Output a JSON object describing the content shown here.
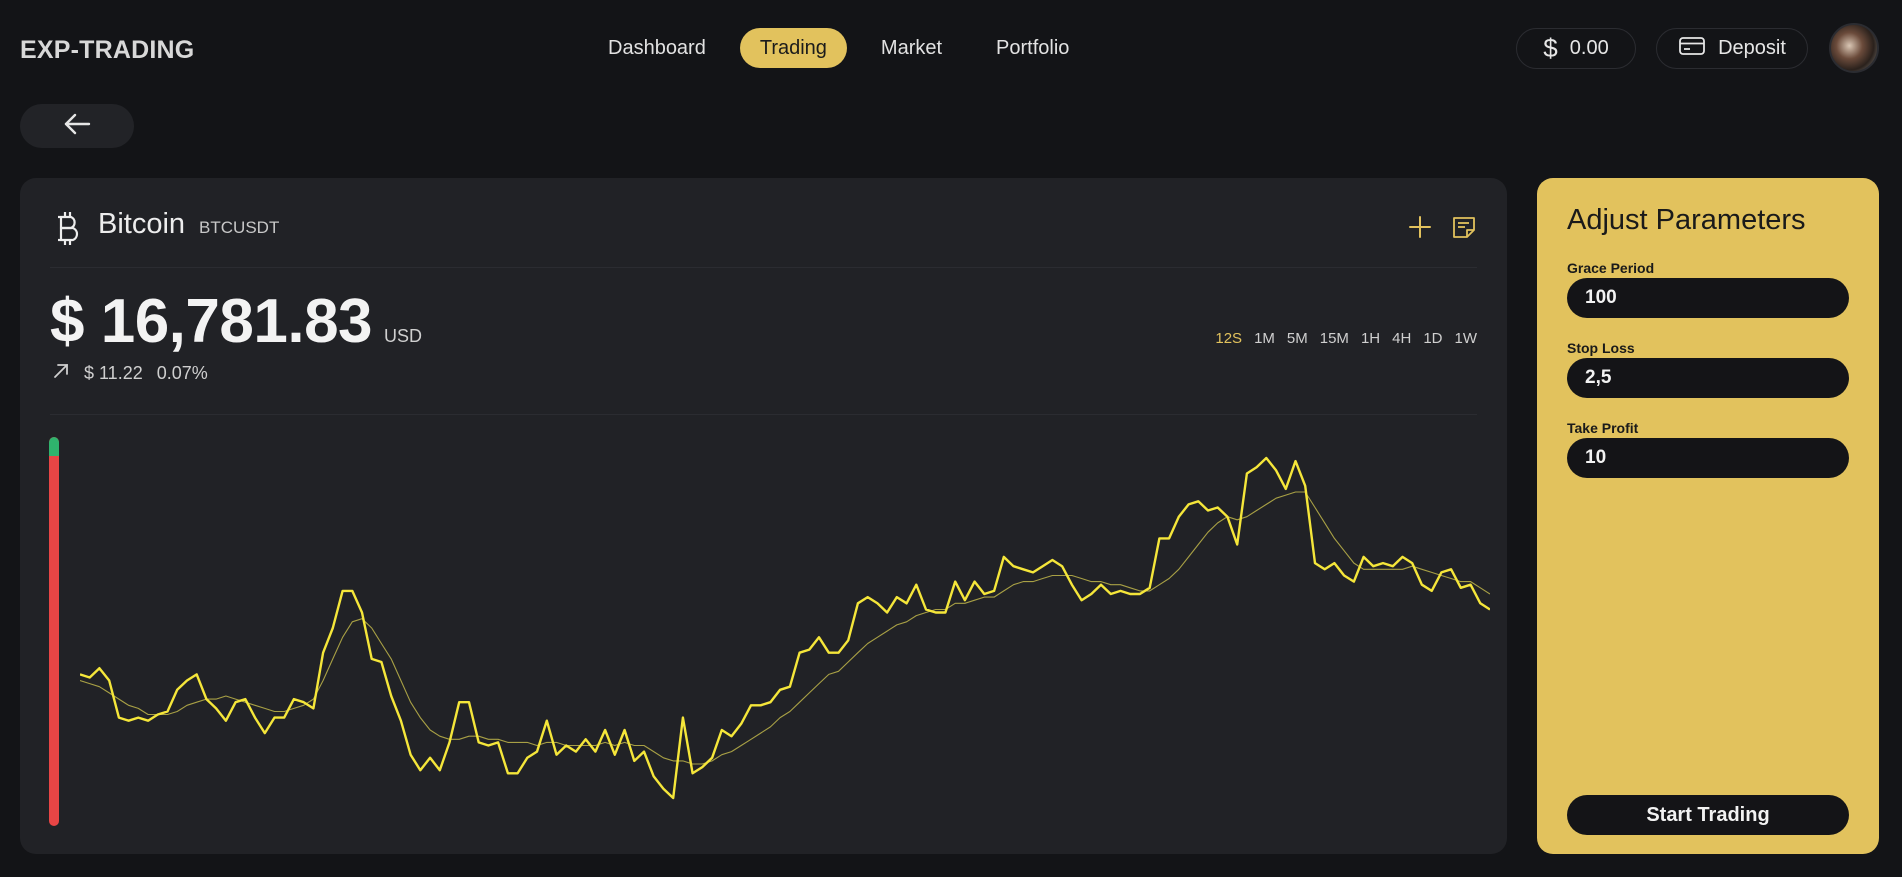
{
  "app": {
    "brand": "EXP-TRADING"
  },
  "nav": {
    "items": [
      {
        "label": "Dashboard",
        "active": false
      },
      {
        "label": "Trading",
        "active": true
      },
      {
        "label": "Market",
        "active": false
      },
      {
        "label": "Portfolio",
        "active": false
      }
    ]
  },
  "header": {
    "balance_icon": "$",
    "balance": "0.00",
    "deposit_label": "Deposit"
  },
  "colors": {
    "accent": "#e2c25d",
    "background": "#131417",
    "card": "#212226",
    "price_line": "#f5e63a",
    "moving_average": "#a8a045",
    "level_up": "#2fb36d",
    "level_down": "#e84545"
  },
  "asset": {
    "name": "Bitcoin",
    "symbol": "BTCUSDT",
    "price": "$ 16,781.83",
    "currency": "USD",
    "change_value": "$ 11.22",
    "change_percent": "0.07%"
  },
  "intervals": [
    "12S",
    "1M",
    "5M",
    "15M",
    "1H",
    "4H",
    "1D",
    "1W"
  ],
  "active_interval": "12S",
  "level_indicator": {
    "up_fraction": 0.05
  },
  "chart_data": {
    "type": "line",
    "grid": false,
    "series": [
      {
        "values": [
          40,
          39,
          42,
          38,
          26,
          25,
          26,
          25,
          27,
          28,
          35,
          38,
          40,
          32,
          29,
          25,
          31,
          32,
          26,
          21,
          26,
          26,
          32,
          31,
          29,
          47,
          55,
          67,
          67,
          60,
          45,
          44,
          33,
          25,
          14,
          9,
          13,
          9,
          18,
          31,
          31,
          18,
          17,
          18,
          8,
          8,
          13,
          15,
          25,
          14,
          17,
          15,
          19,
          15,
          22,
          14,
          22,
          12,
          15,
          7,
          3,
          0,
          26,
          8,
          10,
          13,
          22,
          20,
          24,
          30,
          30,
          31,
          35,
          36,
          47,
          48,
          52,
          47,
          47,
          51,
          63,
          65,
          63,
          60,
          65,
          63,
          69,
          61,
          60,
          60,
          70,
          64,
          70,
          66,
          67,
          78,
          75,
          74,
          73,
          75,
          77,
          75,
          69,
          64,
          66,
          69,
          66,
          67,
          66,
          66,
          68,
          84,
          84,
          91,
          95,
          96,
          93,
          94,
          91,
          82,
          105,
          107,
          110,
          106,
          100,
          109,
          101,
          76,
          74,
          76,
          72,
          70,
          78,
          75,
          76,
          75,
          78,
          76,
          69,
          67,
          73,
          74,
          68,
          69,
          63,
          61
        ],
        "ylim": [
          0,
          110
        ]
      },
      {
        "values": [
          38,
          37,
          36,
          34,
          32,
          30,
          29,
          27,
          27,
          27,
          28,
          30,
          31,
          32,
          32,
          33,
          32,
          31,
          30,
          29,
          28,
          28,
          29,
          30,
          32,
          38,
          45,
          52,
          57,
          58,
          55,
          50,
          45,
          38,
          31,
          26,
          22,
          20,
          19,
          19,
          20,
          20,
          19,
          19,
          18,
          18,
          18,
          17,
          18,
          18,
          17,
          17,
          17,
          17,
          18,
          17,
          18,
          17,
          17,
          15,
          13,
          12,
          12,
          11,
          11,
          12,
          14,
          15,
          17,
          19,
          21,
          23,
          26,
          28,
          31,
          34,
          37,
          40,
          41,
          44,
          47,
          50,
          52,
          54,
          56,
          57,
          59,
          60,
          61,
          61,
          63,
          63,
          64,
          65,
          65,
          67,
          69,
          70,
          70,
          71,
          72,
          72,
          72,
          71,
          70,
          70,
          69,
          69,
          68,
          67,
          67,
          69,
          71,
          74,
          78,
          82,
          86,
          89,
          91,
          90,
          91,
          93,
          95,
          97,
          98,
          99,
          99,
          94,
          89,
          84,
          80,
          76,
          74,
          74,
          74,
          74,
          74,
          75,
          74,
          73,
          72,
          71,
          70,
          70,
          68,
          66
        ],
        "ylim": [
          0,
          110
        ]
      }
    ]
  },
  "params": {
    "title": "Adjust Parameters",
    "fields": [
      {
        "label": "Grace Period",
        "value": "100"
      },
      {
        "label": "Stop Loss",
        "value": "2,5"
      },
      {
        "label": "Take Profit",
        "value": "10"
      }
    ],
    "start_label": "Start Trading"
  }
}
